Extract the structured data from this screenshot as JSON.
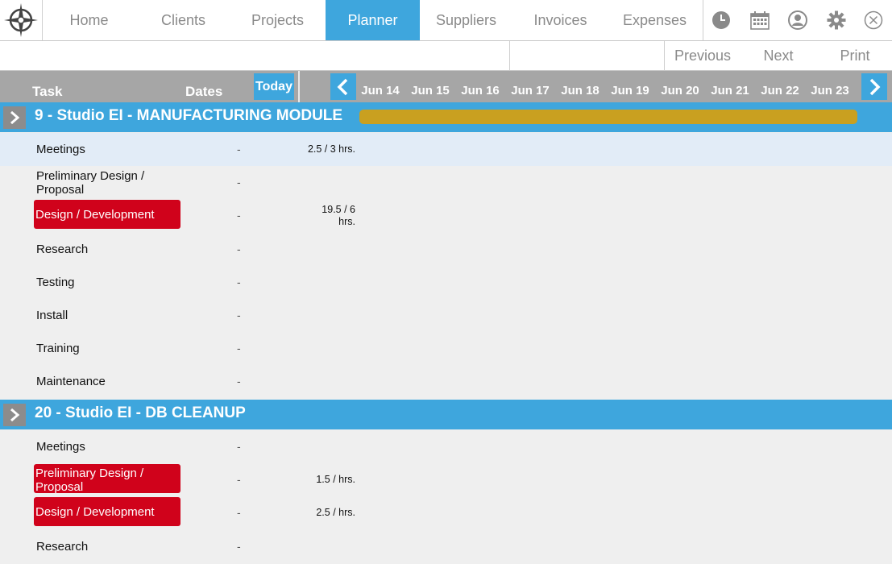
{
  "nav": {
    "items": [
      {
        "label": "Home",
        "active": false
      },
      {
        "label": "Clients",
        "active": false
      },
      {
        "label": "Projects",
        "active": false
      },
      {
        "label": "Planner",
        "active": true
      },
      {
        "label": "Suppliers",
        "active": false
      },
      {
        "label": "Invoices",
        "active": false
      },
      {
        "label": "Expenses",
        "active": false
      }
    ],
    "icons": [
      "clock-icon",
      "calendar-icon",
      "user-icon",
      "gear-icon",
      "close-icon"
    ]
  },
  "subbar": {
    "previous": "Previous",
    "next": "Next",
    "print": "Print"
  },
  "grid": {
    "task_label": "Task",
    "dates_label": "Dates",
    "today_label": "Today",
    "days": [
      "Jun 14",
      "Jun 15",
      "Jun 16",
      "Jun 17",
      "Jun 18",
      "Jun 19",
      "Jun 20",
      "Jun 21",
      "Jun 22",
      "Jun 23"
    ]
  },
  "projects": [
    {
      "title": "9 - Studio EI - MANUFACTURING MODULE",
      "tasks": [
        {
          "name": "Meetings",
          "dates": "-",
          "hours": "2.5 / 3 hrs.",
          "highlight": true,
          "red": false
        },
        {
          "name": "Preliminary Design / Proposal",
          "dates": "-",
          "hours": "",
          "highlight": false,
          "red": false
        },
        {
          "name": "Design / Development",
          "dates": "-",
          "hours": "19.5 / 6 hrs.",
          "highlight": false,
          "red": true
        },
        {
          "name": "Research",
          "dates": "-",
          "hours": "",
          "highlight": false,
          "red": false
        },
        {
          "name": "Testing",
          "dates": "-",
          "hours": "",
          "highlight": false,
          "red": false
        },
        {
          "name": "Install",
          "dates": "-",
          "hours": "",
          "highlight": false,
          "red": false
        },
        {
          "name": "Training",
          "dates": "-",
          "hours": "",
          "highlight": false,
          "red": false
        },
        {
          "name": "Maintenance",
          "dates": "-",
          "hours": "",
          "highlight": false,
          "red": false
        }
      ]
    },
    {
      "title": "20 - Studio EI - DB CLEANUP",
      "tasks": [
        {
          "name": "Meetings",
          "dates": "-",
          "hours": "",
          "highlight": false,
          "red": false
        },
        {
          "name": "Preliminary Design / Proposal",
          "dates": "-",
          "hours": "1.5 /  hrs.",
          "highlight": false,
          "red": true
        },
        {
          "name": "Design / Development",
          "dates": "-",
          "hours": "2.5 /  hrs.",
          "highlight": false,
          "red": true
        },
        {
          "name": "Research",
          "dates": "-",
          "hours": "",
          "highlight": false,
          "red": false
        }
      ]
    }
  ],
  "colors": {
    "accent": "#3ea6dd",
    "task_red": "#d0021b",
    "progress_gold": "#c9a020",
    "header_gray": "#a6a6a6"
  }
}
